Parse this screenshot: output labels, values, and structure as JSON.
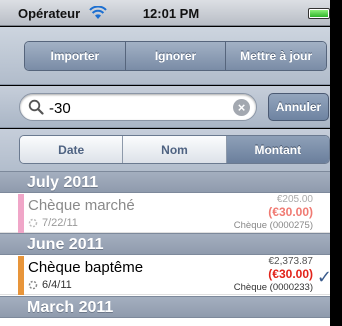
{
  "status_bar": {
    "carrier": "Opérateur",
    "time": "12:01 PM"
  },
  "actions": {
    "import": "Importer",
    "ignore": "Ignorer",
    "update": "Mettre à jour"
  },
  "search": {
    "value": "-30",
    "cancel": "Annuler"
  },
  "sort": {
    "options": [
      "Date",
      "Nom",
      "Montant"
    ],
    "selected": "Montant"
  },
  "sections": [
    {
      "title": "July 2011",
      "rows": [
        {
          "title": "Chèque marché",
          "date": "7/22/11",
          "amount": "€205.00",
          "split": "(€30.00)",
          "type": "Chèque (0000275)",
          "color": "#f0a6c8",
          "checked": false
        }
      ]
    },
    {
      "title": "June 2011",
      "rows": [
        {
          "title": "Chèque baptême",
          "date": "6/4/11",
          "amount": "€2,373.87",
          "split": "(€30.00)",
          "type": "Chèque (0000233)",
          "color": "#e8953a",
          "checked": true
        }
      ]
    },
    {
      "title": "March 2011",
      "rows": []
    }
  ],
  "colors": {
    "accent": "#6b7f9c",
    "negative": "#e2231a"
  }
}
